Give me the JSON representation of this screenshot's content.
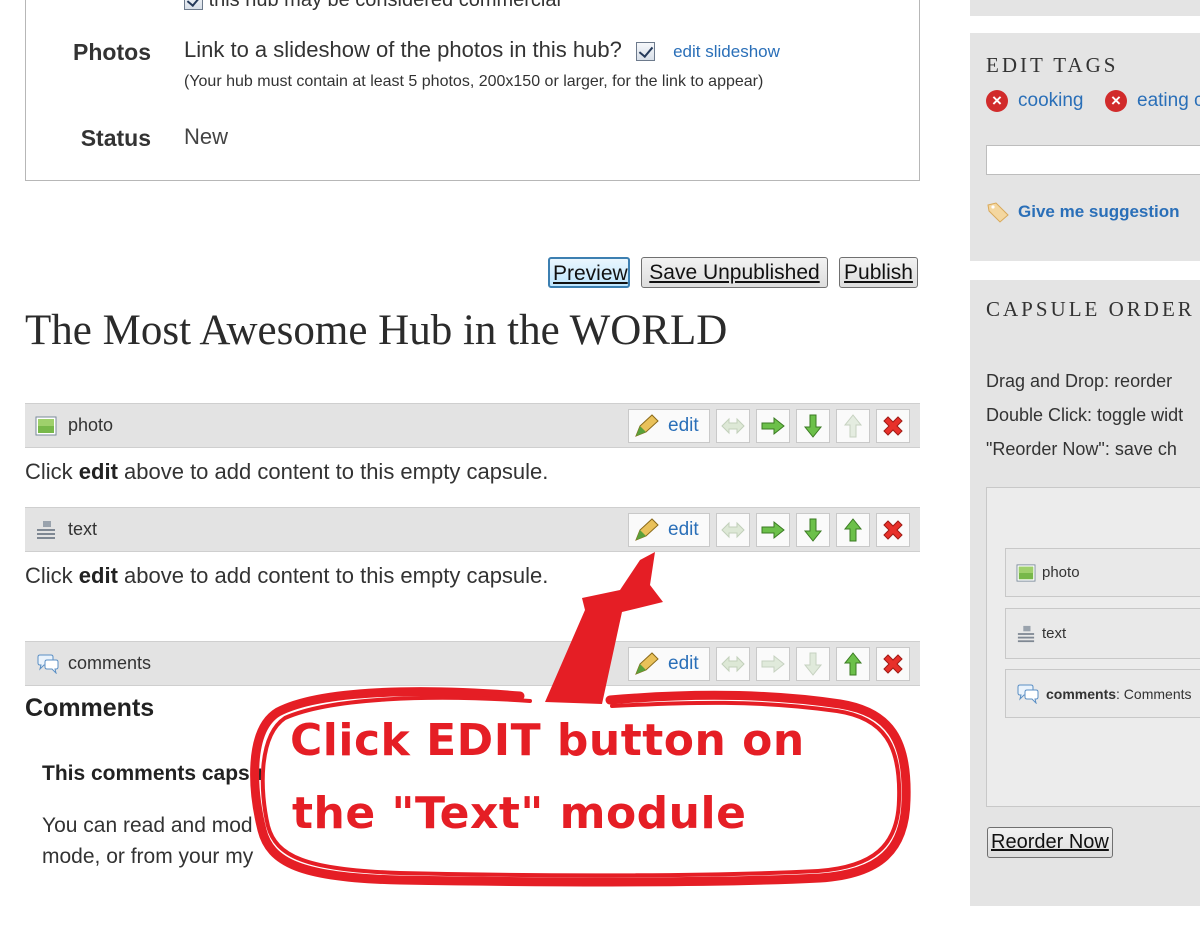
{
  "settings": {
    "commercial_text": "this hub may be considered commercial",
    "commercial_link": "considered commercial",
    "photos_label": "Photos",
    "photos_text": "Link to a slideshow of the photos in this hub?",
    "edit_slideshow": "edit slideshow",
    "photos_note": "(Your hub must contain at least 5 photos, 200x150 or larger, for the link to appear)",
    "status_label": "Status",
    "status_value": "New"
  },
  "toolbar": {
    "preview": "Preview",
    "save_unpublished": "Save Unpublished",
    "publish": "Publish"
  },
  "hub_title": "The Most Awesome Hub in the WORLD",
  "capsules": [
    {
      "name": "photo",
      "edit": "edit",
      "note_pre": "Click ",
      "note_bold": "edit",
      "note_post": " above to add content to this empty capsule."
    },
    {
      "name": "text",
      "edit": "edit",
      "note_pre": "Click ",
      "note_bold": "edit",
      "note_post": " above to add content to this empty capsule."
    },
    {
      "name": "comments",
      "edit": "edit"
    }
  ],
  "comments": {
    "heading": "Comments",
    "sub": "This comments capsu",
    "line1": "You can read and mod",
    "line2": "mode, or from your my"
  },
  "sidebar": {
    "edit_tags_title": "EDIT TAGS",
    "tags": [
      "cooking",
      "eating c"
    ],
    "suggestion_link": "Give me suggestion",
    "capsule_order_title": "CAPSULE ORDER",
    "instructions": [
      "Drag and Drop: reorder",
      "Double Click: toggle widt",
      "\"Reorder Now\": save ch"
    ],
    "order_items": [
      {
        "label": "photo"
      },
      {
        "label": "text"
      },
      {
        "label": "comments",
        "extra": ": Comments"
      }
    ],
    "reorder_button": "Reorder Now"
  },
  "annotation": {
    "line1": "Click EDIT button on",
    "line2": "the \"Text\" module",
    "color": "#e51e25"
  }
}
